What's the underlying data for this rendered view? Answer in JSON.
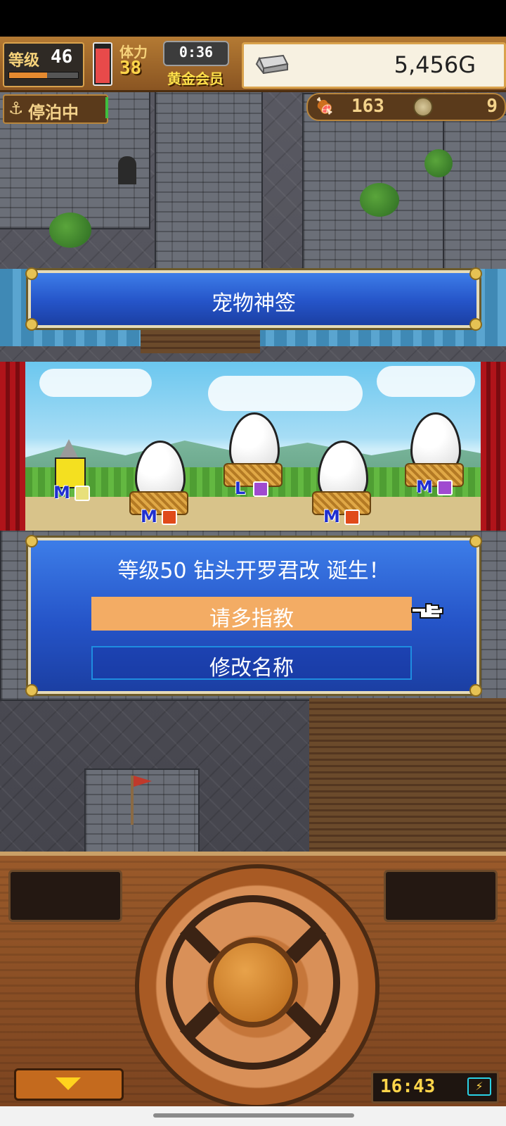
{
  "hud": {
    "level_label": "等级",
    "level_value": "46",
    "exp_fraction": 0.55,
    "stamina_label": "体力",
    "stamina_value": "38",
    "stamina_fraction": 0.9,
    "timer": "0:36",
    "member_label": "黄金会员",
    "gold_value": "5,456G",
    "gold_icon": "silver-bar-icon",
    "anchor_icon": "anchor-icon",
    "anchor_status": "停泊中",
    "meat_icon": "meat-icon",
    "meat_value": "163",
    "medal_icon": "medal-icon",
    "medal_value": "9"
  },
  "title_panel": {
    "title": "宠物神签"
  },
  "stage": {
    "pets": [
      {
        "name": "drill-pet",
        "size": "M",
        "tag_color": "#e8e07a"
      },
      {
        "name": "egg-1",
        "size": "M",
        "tag_color": "#e04a1a"
      },
      {
        "name": "egg-2",
        "size": "L",
        "tag_color": "#a04ad0"
      },
      {
        "name": "egg-3",
        "size": "M",
        "tag_color": "#e04a1a"
      },
      {
        "name": "egg-4",
        "size": "M",
        "tag_color": "#a04ad0"
      }
    ]
  },
  "dialog": {
    "message": "等级50 钻头开罗君改 诞生！",
    "option_greet": "请多指教",
    "option_rename": "修改名称",
    "pointer_icon": "pointing-hand-icon"
  },
  "controller": {
    "clock": "16:43",
    "battery_icon": "battery-charging-icon",
    "menu_icon": "down-arrow-icon"
  },
  "colors": {
    "panel_blue": "#2554c8",
    "highlight_orange": "#f3ac64",
    "gold_text": "#ffd54a"
  }
}
